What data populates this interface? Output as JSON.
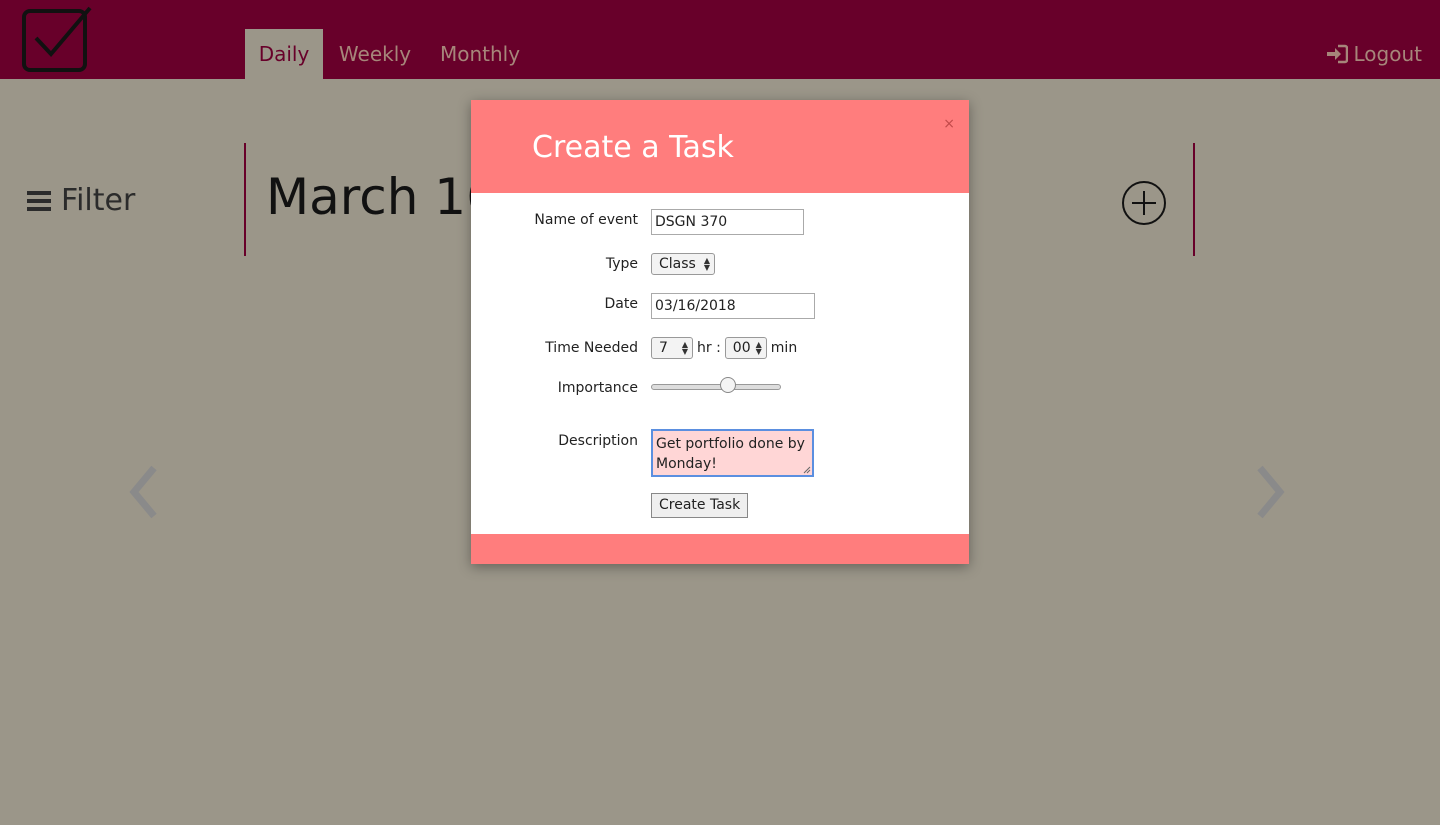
{
  "nav": {
    "tabs": [
      {
        "label": "Daily",
        "active": true
      },
      {
        "label": "Weekly",
        "active": false
      },
      {
        "label": "Monthly",
        "active": false
      }
    ],
    "logout_label": "Logout",
    "logo_icon": "checkbox-logo-icon",
    "logout_icon": "sign-in-icon"
  },
  "page": {
    "filter_label": "Filter",
    "filter_icon": "hamburger-icon",
    "date_title": "March 16",
    "add_icon": "plus-circle-icon",
    "prev_icon": "chevron-left-icon",
    "next_icon": "chevron-right-icon"
  },
  "modal": {
    "title": "Create a Task",
    "close_label": "×",
    "fields": {
      "name_label": "Name of event",
      "name_value": "DSGN 370",
      "type_label": "Type",
      "type_value": "Class",
      "date_label": "Date",
      "date_value": "03/16/2018",
      "time_label": "Time Needed",
      "hours_value": "7",
      "hr_unit": "hr :",
      "minutes_value": "00",
      "min_unit": "min",
      "importance_label": "Importance",
      "importance_level": 0.6,
      "description_label": "Description",
      "description_value": "Get portfolio done by Monday!"
    },
    "submit_label": "Create Task"
  },
  "colors": {
    "nav_bg": "#68002a",
    "page_bg": "#9b9689",
    "modal_accent": "#ff7d7d",
    "textarea_bg": "#ffd6d6",
    "focus_ring": "#5b8fe0"
  }
}
